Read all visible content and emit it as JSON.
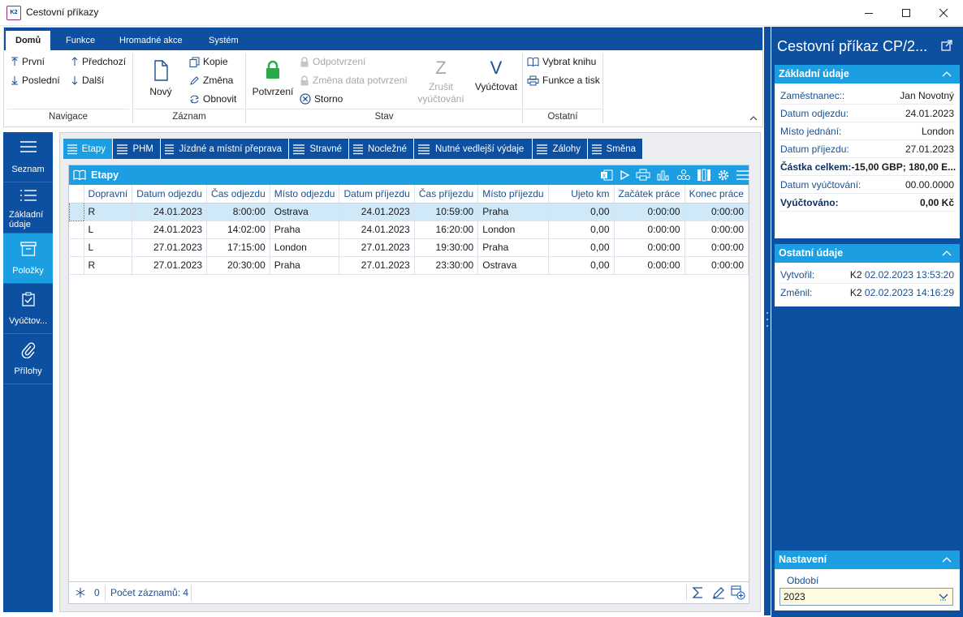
{
  "window": {
    "title": "Cestovní příkazy",
    "logo_text": "K2"
  },
  "ribbon": {
    "tabs": [
      "Domů",
      "Funkce",
      "Hromadné akce",
      "Systém"
    ],
    "navigace": {
      "first": "První",
      "last": "Poslední",
      "prev": "Předchozí",
      "next": "Další",
      "label": "Navigace"
    },
    "zaznam": {
      "new": "Nový",
      "copy": "Kopie",
      "change": "Změna",
      "refresh": "Obnovit",
      "label": "Záznam"
    },
    "stav": {
      "confirm": "Potvrzení",
      "unconfirm": "Odpotvrzení",
      "change_date": "Změna data potvrzení",
      "cancel": "Storno",
      "cancel_settle_1": "Zrušit",
      "cancel_settle_2": "vyúčtování",
      "settle": "Vyúčtovat",
      "label": "Stav",
      "z_letter": "Z",
      "v_letter": "V"
    },
    "ostatni": {
      "choose_book": "Vybrat knihu",
      "functions_print": "Funkce a tisk",
      "label": "Ostatní"
    }
  },
  "leftnav": [
    {
      "label": "Seznam"
    },
    {
      "label": "Základní údaje"
    },
    {
      "label": "Položky"
    },
    {
      "label": "Vyúčtov..."
    },
    {
      "label": "Přílohy"
    }
  ],
  "detail_tabs": [
    "Etapy",
    "PHM",
    "Jízdné a místní přeprava",
    "Stravné",
    "Nocležné",
    "Nutné vedlejší výdaje",
    "Zálohy",
    "Směna"
  ],
  "grid": {
    "title": "Etapy",
    "columns": [
      "Dopravní",
      "Datum odjezdu",
      "Čas odjezdu",
      "Místo odjezdu",
      "Datum příjezdu",
      "Čas příjezdu",
      "Místo příjezdu",
      "Ujeto km",
      "Začátek práce",
      "Konec práce"
    ],
    "rows": [
      [
        "R",
        "24.01.2023",
        "8:00:00",
        "Ostrava",
        "24.01.2023",
        "10:59:00",
        "Praha",
        "0,00",
        "0:00:00",
        "0:00:00"
      ],
      [
        "L",
        "24.01.2023",
        "14:02:00",
        "Praha",
        "24.01.2023",
        "16:20:00",
        "London",
        "0,00",
        "0:00:00",
        "0:00:00"
      ],
      [
        "L",
        "27.01.2023",
        "17:15:00",
        "London",
        "27.01.2023",
        "19:30:00",
        "Praha",
        "0,00",
        "0:00:00",
        "0:00:00"
      ],
      [
        "R",
        "27.01.2023",
        "20:30:00",
        "Praha",
        "27.01.2023",
        "23:30:00",
        "Ostrava",
        "0,00",
        "0:00:00",
        "0:00:00"
      ]
    ],
    "footer": {
      "count": "0",
      "records": "Počet záznamů: 4"
    }
  },
  "rpanel": {
    "title": "Cestovní příkaz CP/2...",
    "basic": {
      "header": "Základní údaje",
      "rows": [
        {
          "k": "Zaměstnanec::",
          "v": "Jan Novotný"
        },
        {
          "k": "Datum odjezdu:",
          "v": "24.01.2023"
        },
        {
          "k": "Místo jednání:",
          "v": "London"
        },
        {
          "k": "Datum příjezdu:",
          "v": "27.01.2023"
        },
        {
          "k": "Částka celkem:",
          "v": "-15,00 GBP; 180,00 E..."
        },
        {
          "k": "Datum vyúčtování:",
          "v": "00.00.0000"
        },
        {
          "k": "Vyúčtováno:",
          "v": "0,00 Kč"
        }
      ]
    },
    "other": {
      "header": "Ostatní údaje",
      "created_label": "Vytvořil:",
      "created_user": "K2",
      "created_date": "02.02.2023 13:53:20",
      "changed_label": "Změnil:",
      "changed_user": "K2",
      "changed_date": "02.02.2023 14:16:29"
    },
    "settings": {
      "header": "Nastavení",
      "period_label": "Období",
      "period_value": "2023"
    }
  },
  "colors": {
    "ribbon_blue": "#0d4fa0",
    "accent": "#1b9fe2",
    "selected_row": "#cfe9f9",
    "confirm_green": "#2aa84a",
    "period_field": "#fffbe0"
  }
}
